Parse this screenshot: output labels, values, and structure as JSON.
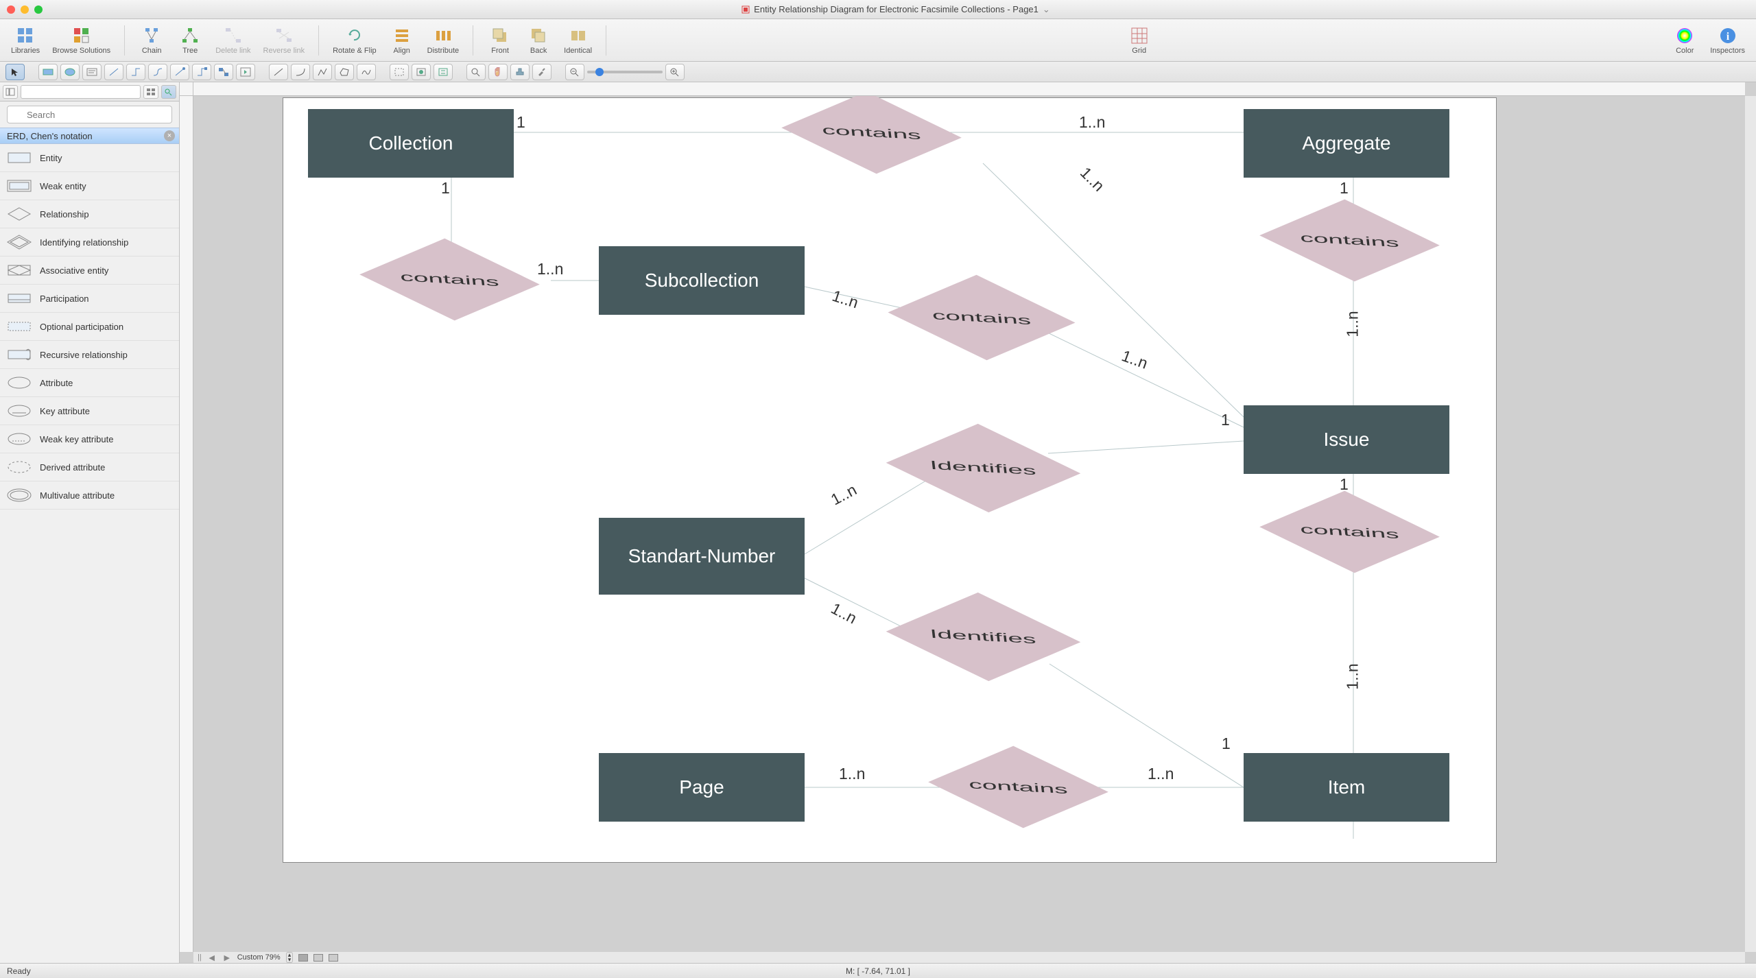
{
  "title": "Entity Relationship Diagram for Electronic Facsimile Collections - Page1",
  "toolbar": {
    "libraries": "Libraries",
    "browse_solutions": "Browse Solutions",
    "chain": "Chain",
    "tree": "Tree",
    "delete_link": "Delete link",
    "reverse_link": "Reverse link",
    "rotate_flip": "Rotate & Flip",
    "align": "Align",
    "distribute": "Distribute",
    "front": "Front",
    "back": "Back",
    "identical": "Identical",
    "grid": "Grid",
    "color": "Color",
    "inspectors": "Inspectors"
  },
  "search": {
    "placeholder": "Search"
  },
  "library": {
    "name": "ERD, Chen's notation",
    "shapes": [
      "Entity",
      "Weak entity",
      "Relationship",
      "Identifying relationship",
      "Associative entity",
      "Participation",
      "Optional participation",
      "Recursive relationship",
      "Attribute",
      "Key attribute",
      "Weak key attribute",
      "Derived attribute",
      "Multivalue attribute"
    ]
  },
  "diagram": {
    "entities": {
      "collection": "Collection",
      "aggregate": "Aggregate",
      "subcollection": "Subcollection",
      "issue": "Issue",
      "standart_number": "Standart-Number",
      "page": "Page",
      "item": "Item"
    },
    "relationships": {
      "contains": "contains",
      "identifies": "Identifies"
    },
    "cardinality": {
      "one": "1",
      "one_n": "1..n"
    }
  },
  "zoom": {
    "label": "Custom 79%"
  },
  "status": {
    "ready": "Ready",
    "mouse": "M: [ -7.64, 71.01 ]"
  }
}
